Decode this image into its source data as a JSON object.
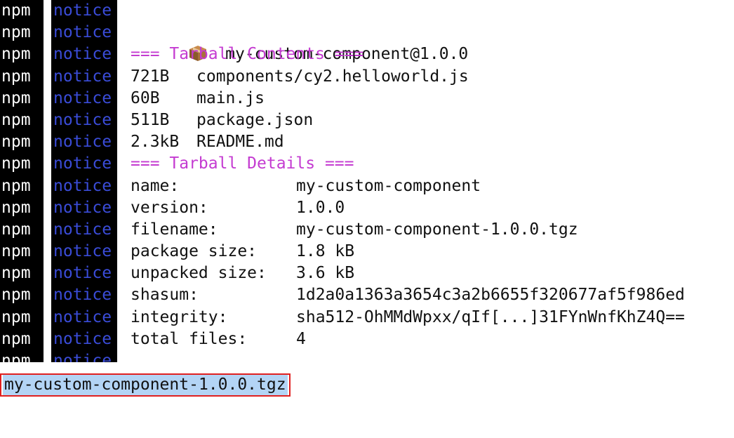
{
  "prefix": {
    "npm": "npm",
    "notice": "notice"
  },
  "header": {
    "package_id": "my-custom-component@1.0.0",
    "icon": "package-box-icon"
  },
  "contents": {
    "heading": "=== Tarball Contents ===",
    "files": [
      {
        "size": "721B",
        "name": "components/cy2.helloworld.js"
      },
      {
        "size": "60B",
        "name": "main.js"
      },
      {
        "size": "511B",
        "name": "package.json"
      },
      {
        "size": "2.3kB",
        "name": "README.md"
      }
    ]
  },
  "details": {
    "heading": "=== Tarball Details ===",
    "rows": [
      {
        "key": "name:",
        "value": "my-custom-component"
      },
      {
        "key": "version:",
        "value": "1.0.0"
      },
      {
        "key": "filename:",
        "value": "my-custom-component-1.0.0.tgz"
      },
      {
        "key": "package size:",
        "value": "1.8 kB"
      },
      {
        "key": "unpacked size:",
        "value": "3.6 kB"
      },
      {
        "key": "shasum:",
        "value": "1d2a0a1363a3654c3a2b6655f320677af5f986ed"
      },
      {
        "key": "integrity:",
        "value": "sha512-OhMMdWpxx/qIf[...]31FYnWnfKhZ4Q=="
      },
      {
        "key": "total files:",
        "value": "4"
      }
    ]
  },
  "result": {
    "filename": "my-custom-component-1.0.0.tgz"
  },
  "colors": {
    "notice": "#3a4cd8",
    "heading": "#c43bd1",
    "highlight": "#b3d4f5",
    "outline": "#e02020"
  }
}
